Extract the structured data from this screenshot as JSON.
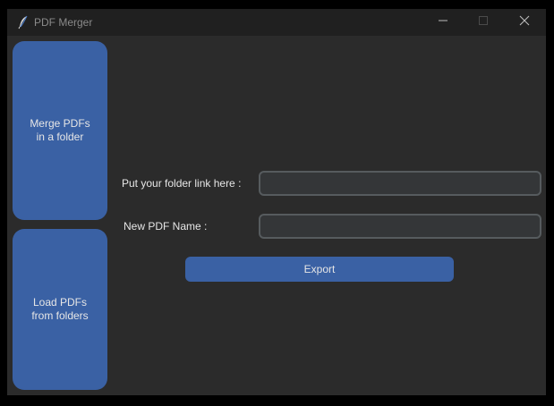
{
  "window": {
    "title": "PDF Merger",
    "icon": "feather-icon",
    "controls": [
      "minimize-icon",
      "maximize-icon",
      "close-icon"
    ]
  },
  "sidebar": {
    "items": [
      {
        "label": "Merge PDFs\nin a folder"
      },
      {
        "label": "Load PDFs\nfrom folders"
      }
    ]
  },
  "form": {
    "folder_label": "Put your folder link here :",
    "folder_value": "",
    "folder_placeholder": "",
    "name_label": "New PDF Name :",
    "name_value": "",
    "name_placeholder": "",
    "export_label": "Export"
  },
  "colors": {
    "background": "#2b2b2b",
    "titlebar": "#202020",
    "accent": "#3a61a4",
    "field_bg": "#343638",
    "field_border": "#565b5e"
  }
}
